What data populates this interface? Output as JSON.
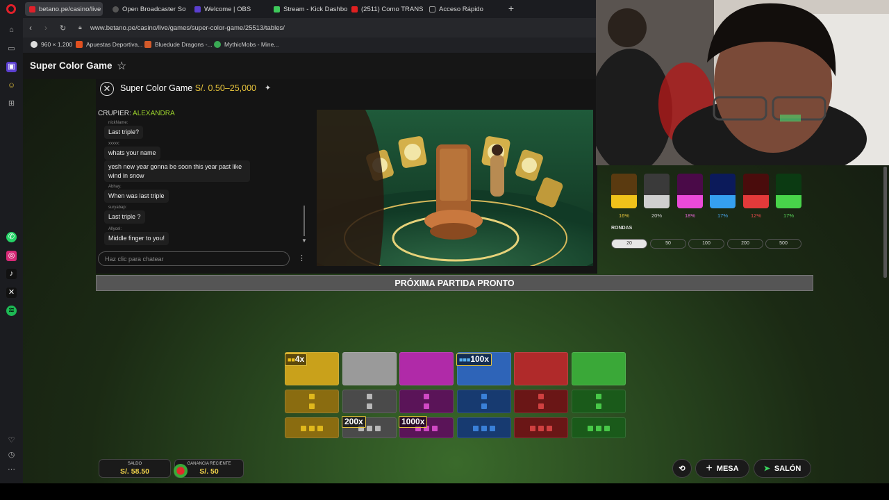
{
  "browser": {
    "tabs": [
      {
        "label": "betano.pe/casino/live",
        "color": "#e0202a"
      },
      {
        "label": "Open Broadcaster Softwa",
        "color": "#555"
      },
      {
        "label": "Welcome | OBS",
        "color": "#5b3fd0"
      },
      {
        "label": "Stream - Kick Dashboard",
        "color": "#3ec95b"
      },
      {
        "label": "(2511) Como TRANSMITIR",
        "color": "#e02020"
      },
      {
        "label": "Acceso Rápido",
        "color": "#999"
      }
    ],
    "new_tab": "+",
    "url": "www.betano.pe/casino/live/games/super-color-game/25513/tables/",
    "bookmarks": [
      {
        "label": "960 × 1.200",
        "color": "#ddd"
      },
      {
        "label": "Apuestas Deportiva...",
        "color": "#e05020"
      },
      {
        "label": "Bluedude Dragons -...",
        "color": "#d35a2a"
      },
      {
        "label": "MythicMobs - Mine...",
        "color": "#3aaa55"
      }
    ]
  },
  "page": {
    "title": "Super Color Game"
  },
  "game": {
    "title": "Super Color Game",
    "limits": "S/. 0.50–25,000",
    "dealer_label": "CRUPIER:",
    "dealer_name": "ALEXANDRA",
    "chat": [
      {
        "user": "nickName:",
        "text": "Last triple?"
      },
      {
        "user": "xxxxx:",
        "text": "whats your name"
      },
      {
        "user": "",
        "text": "yesh new year gonna be soon this year past like wind in snow"
      },
      {
        "user": "Abhay:",
        "text": "When was last triple"
      },
      {
        "user": "suryabap:",
        "text": "Last triple ?"
      },
      {
        "user": "Allycel:",
        "text": "Middle finger to you!"
      }
    ],
    "chat_placeholder": "Haz clic para chatear",
    "stats": [
      {
        "top": "#5a3a10",
        "bottom": "#f0c21a",
        "pct": "16%",
        "pct_color": "#e8c53c"
      },
      {
        "top": "#3a3a3a",
        "bottom": "#cfcfcf",
        "pct": "20%",
        "pct_color": "#cfcfcf"
      },
      {
        "top": "#4a0a48",
        "bottom": "#ea4ad8",
        "pct": "18%",
        "pct_color": "#e868d6"
      },
      {
        "top": "#0b1a5a",
        "bottom": "#35a0f0",
        "pct": "17%",
        "pct_color": "#4aa8f0"
      },
      {
        "top": "#4a0c0c",
        "bottom": "#e33a3a",
        "pct": "12%",
        "pct_color": "#e84a4a"
      },
      {
        "top": "#0b3a12",
        "bottom": "#48d44a",
        "pct": "17%",
        "pct_color": "#5ad85a"
      }
    ],
    "rounds_label": "RONDAS",
    "rounds": [
      "20",
      "50",
      "100",
      "200",
      "500"
    ],
    "banner": "PRÓXIMA PARTIDA PRONTO",
    "board_colors": [
      {
        "name": "yellow",
        "main": "#c9a11b",
        "dark": "#8a6c10",
        "sq": "#e0b81c"
      },
      {
        "name": "gray",
        "main": "#9a9a9a",
        "dark": "#4a4a4a",
        "sq": "#b8b8b8"
      },
      {
        "name": "pink",
        "main": "#b02aa8",
        "dark": "#5a1458",
        "sq": "#d048c4"
      },
      {
        "name": "blue",
        "main": "#2e64b8",
        "dark": "#173a70",
        "sq": "#3a80d8"
      },
      {
        "name": "red",
        "main": "#b02a2a",
        "dark": "#6a1616",
        "sq": "#d04040"
      },
      {
        "name": "green",
        "main": "#3aa838",
        "dark": "#1a5a1a",
        "sq": "#48c848"
      }
    ],
    "multipliers": {
      "yellow_single": "4x",
      "blue_single": "100x",
      "gray_triple": "200x",
      "pink_triple": "1000x"
    },
    "balance_label": "SALDO",
    "balance_value": "S/. 58.50",
    "recent_win_label": "GANANCIA RECIENTE",
    "recent_win_value": "S/. 50",
    "table_button": "MESA",
    "lobby_button": "SALÓN"
  }
}
